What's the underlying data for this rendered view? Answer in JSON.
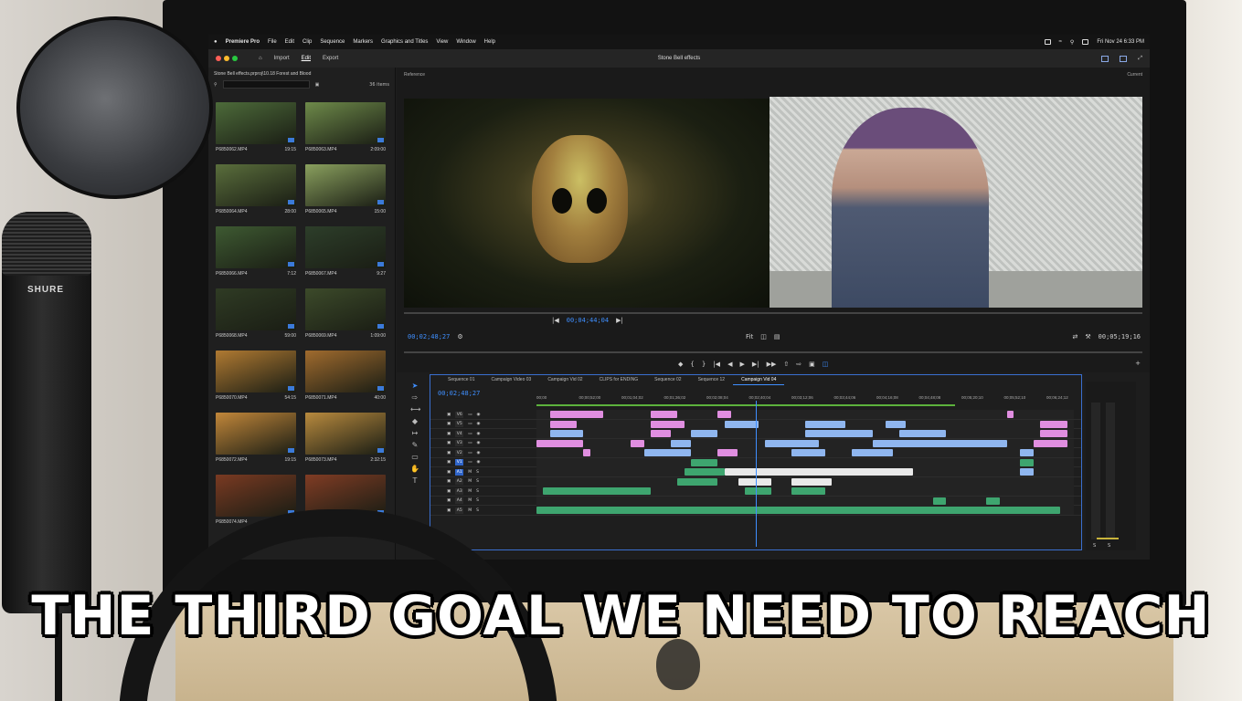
{
  "menubar": {
    "app": "Premiere Pro",
    "items": [
      "File",
      "Edit",
      "Clip",
      "Sequence",
      "Markers",
      "Graphics and Titles",
      "View",
      "Window",
      "Help"
    ],
    "clock": "Fri Nov 24  6:33 PM"
  },
  "appbar": {
    "nav": [
      "Import",
      "Edit",
      "Export"
    ],
    "active_nav": "Edit",
    "title": "Stone Bell effects"
  },
  "project": {
    "path": "Stone Bell effects.prproj\\10.18 Forest and Blood",
    "item_count": "36 items",
    "clips": [
      {
        "name": "P6850062.MP4",
        "dur": "19:15",
        "tone": "#4d6b3a"
      },
      {
        "name": "P6850063.MP4",
        "dur": "2:09:00",
        "tone": "#6e8a4a"
      },
      {
        "name": "P6850064.MP4",
        "dur": "28:00",
        "tone": "#5a6e3c"
      },
      {
        "name": "P6850065.MP4",
        "dur": "15:00",
        "tone": "#8aa05e"
      },
      {
        "name": "P6850066.MP4",
        "dur": "7:12",
        "tone": "#3e5a32"
      },
      {
        "name": "P6850067.MP4",
        "dur": "9:27",
        "tone": "#2d3e2a"
      },
      {
        "name": "P6850068.MP4",
        "dur": "59:00",
        "tone": "#2f3b24"
      },
      {
        "name": "P6850069.MP4",
        "dur": "1:09:00",
        "tone": "#3c4a2a"
      },
      {
        "name": "P6850070.MP4",
        "dur": "54:15",
        "tone": "#b07a32"
      },
      {
        "name": "P6850071.MP4",
        "dur": "40:00",
        "tone": "#a06b2e"
      },
      {
        "name": "P6850072.MP4",
        "dur": "19:15",
        "tone": "#c2873a"
      },
      {
        "name": "P6850073.MP4",
        "dur": "2:32:15",
        "tone": "#b88a3e"
      },
      {
        "name": "P6850074.MP4",
        "dur": "",
        "tone": "#7a3a22"
      },
      {
        "name": "",
        "dur": "",
        "tone": "#803c24"
      }
    ]
  },
  "monitors": {
    "reference_label": "Reference",
    "current_label": "Current",
    "source_tc": "00;02;48;27",
    "ref_tc": "00;04;44;04",
    "fit_label": "Fit",
    "program_tc": "00;05;19;16"
  },
  "timeline": {
    "tabs": [
      "Sequence 01",
      "Campaign Video 03",
      "Campaign Vid 02",
      "CLIPS for ENDING",
      "Sequence 02",
      "Sequence 12",
      "Campaign Vid 04"
    ],
    "active_tab": "Campaign Vid 04",
    "timecode": "00;02;48;27",
    "ruler": [
      "00;00",
      "00;00;52;00",
      "00;01;04;02",
      "00;01;36;02",
      "00;02;08;04",
      "00;02;40;04",
      "00;03;12;06",
      "00;03;44;06",
      "00;04;16;08",
      "00;04;48;08",
      "00;05;20;10",
      "00;05;52;10",
      "00;06;24;12"
    ],
    "tracks": [
      {
        "id": "V6",
        "kind": "video",
        "clips": [
          {
            "s": 2,
            "w": 8,
            "c": "pk"
          },
          {
            "s": 17,
            "w": 4,
            "c": "pk"
          },
          {
            "s": 27,
            "w": 2,
            "c": "pk"
          },
          {
            "s": 70,
            "w": 1,
            "c": "pk"
          }
        ]
      },
      {
        "id": "V5",
        "kind": "video",
        "clips": [
          {
            "s": 2,
            "w": 4,
            "c": "pk"
          },
          {
            "s": 17,
            "w": 5,
            "c": "pk"
          },
          {
            "s": 28,
            "w": 5,
            "c": "bl"
          },
          {
            "s": 40,
            "w": 6,
            "c": "bl"
          },
          {
            "s": 52,
            "w": 3,
            "c": "bl"
          },
          {
            "s": 75,
            "w": 4,
            "c": "pk"
          }
        ]
      },
      {
        "id": "V4",
        "kind": "video",
        "clips": [
          {
            "s": 2,
            "w": 5,
            "c": "bl"
          },
          {
            "s": 17,
            "w": 3,
            "c": "pk"
          },
          {
            "s": 23,
            "w": 4,
            "c": "bl"
          },
          {
            "s": 40,
            "w": 10,
            "c": "bl"
          },
          {
            "s": 54,
            "w": 7,
            "c": "bl"
          },
          {
            "s": 75,
            "w": 4,
            "c": "pk"
          }
        ]
      },
      {
        "id": "V3",
        "kind": "video",
        "clips": [
          {
            "s": 0,
            "w": 7,
            "c": "pk"
          },
          {
            "s": 14,
            "w": 2,
            "c": "pk"
          },
          {
            "s": 20,
            "w": 3,
            "c": "bl"
          },
          {
            "s": 34,
            "w": 8,
            "c": "bl"
          },
          {
            "s": 50,
            "w": 20,
            "c": "bl"
          },
          {
            "s": 74,
            "w": 5,
            "c": "pk"
          }
        ]
      },
      {
        "id": "V2",
        "kind": "video",
        "clips": [
          {
            "s": 7,
            "w": 1,
            "c": "pk"
          },
          {
            "s": 16,
            "w": 7,
            "c": "bl"
          },
          {
            "s": 27,
            "w": 3,
            "c": "pk"
          },
          {
            "s": 38,
            "w": 5,
            "c": "bl"
          },
          {
            "s": 47,
            "w": 6,
            "c": "bl"
          },
          {
            "s": 72,
            "w": 2,
            "c": "bl"
          }
        ]
      },
      {
        "id": "V1",
        "kind": "video",
        "clips": [
          {
            "s": 23,
            "w": 4,
            "c": "gr"
          },
          {
            "s": 72,
            "w": 2,
            "c": "gr"
          }
        ]
      },
      {
        "id": "A1",
        "kind": "audio",
        "clips": [
          {
            "s": 22,
            "w": 6,
            "c": "gr"
          },
          {
            "s": 28,
            "w": 28,
            "c": "wh"
          },
          {
            "s": 72,
            "w": 2,
            "c": "bl"
          }
        ]
      },
      {
        "id": "A2",
        "kind": "audio",
        "clips": [
          {
            "s": 21,
            "w": 6,
            "c": "gr"
          },
          {
            "s": 30,
            "w": 5,
            "c": "wh"
          },
          {
            "s": 38,
            "w": 6,
            "c": "wh"
          }
        ]
      },
      {
        "id": "A3",
        "kind": "audio",
        "clips": [
          {
            "s": 1,
            "w": 16,
            "c": "gr"
          },
          {
            "s": 31,
            "w": 4,
            "c": "gr"
          },
          {
            "s": 38,
            "w": 5,
            "c": "gr"
          }
        ]
      },
      {
        "id": "A4",
        "kind": "audio",
        "clips": [
          {
            "s": 59,
            "w": 2,
            "c": "gr"
          },
          {
            "s": 67,
            "w": 2,
            "c": "gr"
          }
        ]
      },
      {
        "id": "A5",
        "kind": "audio",
        "clips": [
          {
            "s": 0,
            "w": 78,
            "c": "gr"
          }
        ]
      }
    ],
    "vu_labels": [
      "S",
      "S"
    ]
  },
  "props": {
    "mic_brand": "SHURE"
  },
  "caption": "THE THIRD GOAL WE NEED TO REACH"
}
